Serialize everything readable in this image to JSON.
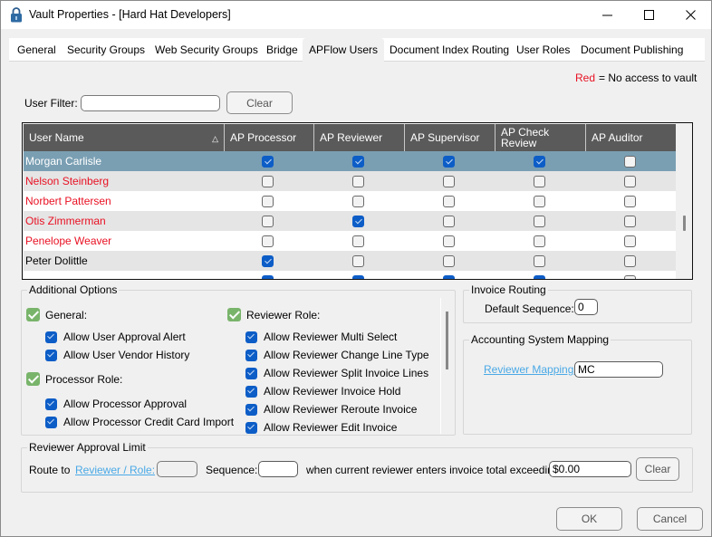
{
  "window": {
    "title": "Vault Properties - [Hard Hat Developers]",
    "icon": "lock-icon"
  },
  "tabs": [
    {
      "label": "General",
      "active": false
    },
    {
      "label": "Security Groups",
      "active": false
    },
    {
      "label": "Web Security Groups",
      "active": false
    },
    {
      "label": "Bridge",
      "active": false
    },
    {
      "label": "APFlow Users",
      "active": true
    },
    {
      "label": "Document Index Routing",
      "active": false
    },
    {
      "label": "User Roles",
      "active": false
    },
    {
      "label": "Document Publishing",
      "active": false
    }
  ],
  "legend": {
    "red_label": "Red",
    "text": "= No access to vault",
    "red_color": "#e81123"
  },
  "filter": {
    "label": "User Filter:",
    "value": "",
    "placeholder": "",
    "clear_label": "Clear"
  },
  "grid": {
    "columns": [
      "User Name",
      "AP Processor",
      "AP Reviewer",
      "AP Supervisor",
      "AP Check Review",
      "AP Auditor"
    ],
    "sort_column": "User Name",
    "sort_icon": "sort-ascending-icon",
    "selected_color": "#7a9fb3",
    "rows": [
      {
        "name": "Morgan Carlisle",
        "no_access": false,
        "selected": true,
        "roles": [
          true,
          true,
          true,
          true,
          false
        ]
      },
      {
        "name": "Nelson Steinberg",
        "no_access": true,
        "selected": false,
        "roles": [
          false,
          false,
          false,
          false,
          false
        ]
      },
      {
        "name": "Norbert Pattersen",
        "no_access": true,
        "selected": false,
        "roles": [
          false,
          false,
          false,
          false,
          false
        ]
      },
      {
        "name": "Otis Zimmerman",
        "no_access": true,
        "selected": false,
        "roles": [
          false,
          true,
          false,
          false,
          false
        ]
      },
      {
        "name": "Penelope Weaver",
        "no_access": true,
        "selected": false,
        "roles": [
          false,
          false,
          false,
          false,
          false
        ]
      },
      {
        "name": "Peter Dolittle",
        "no_access": false,
        "selected": false,
        "roles": [
          true,
          false,
          false,
          false,
          false
        ]
      },
      {
        "name": "",
        "no_access": false,
        "selected": false,
        "roles": [
          true,
          true,
          true,
          true,
          false
        ]
      }
    ]
  },
  "additional_options": {
    "title": "Additional Options",
    "groups": [
      {
        "label": "General:",
        "checked": true,
        "items": [
          {
            "label": "Allow User Approval Alert",
            "checked": true
          },
          {
            "label": "Allow User Vendor History",
            "checked": true
          }
        ]
      },
      {
        "label": "Processor Role:",
        "checked": true,
        "items": [
          {
            "label": "Allow Processor Approval",
            "checked": true
          },
          {
            "label": "Allow Processor Credit Card Import",
            "checked": true
          }
        ]
      },
      {
        "label": "Reviewer Role:",
        "checked": true,
        "items": [
          {
            "label": "Allow Reviewer Multi Select",
            "checked": true
          },
          {
            "label": "Allow Reviewer Change Line Type",
            "checked": true
          },
          {
            "label": "Allow Reviewer Split Invoice Lines",
            "checked": true
          },
          {
            "label": "Allow Reviewer Invoice Hold",
            "checked": true
          },
          {
            "label": "Allow Reviewer Reroute Invoice",
            "checked": true
          },
          {
            "label": "Allow Reviewer Edit Invoice",
            "checked": true
          }
        ]
      }
    ]
  },
  "invoice_routing": {
    "title": "Invoice Routing",
    "default_sequence_label": "Default Sequence:",
    "default_sequence_value": "0"
  },
  "accounting_mapping": {
    "title": "Accounting System Mapping",
    "reviewer_mapping_label": "Reviewer Mapping:",
    "reviewer_mapping_value": "MC"
  },
  "approval_limit": {
    "title": "Reviewer Approval Limit",
    "route_to_label": "Route to",
    "reviewer_role_link": "Reviewer / Role:",
    "reviewer_role_value": "",
    "sequence_label": "Sequence:",
    "sequence_value": "",
    "condition_text": "when current reviewer enters invoice total exceeding:",
    "amount_value": "$0.00",
    "clear_label": "Clear"
  },
  "footer": {
    "ok_label": "OK",
    "cancel_label": "Cancel"
  }
}
